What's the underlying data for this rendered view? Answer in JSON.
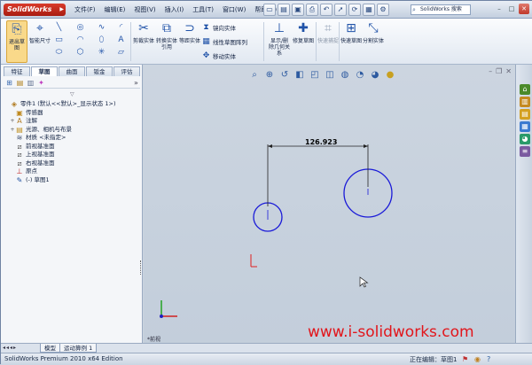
{
  "app": {
    "logo_text": "SolidWorks",
    "menu": [
      "文件(F)",
      "编辑(E)",
      "视图(V)",
      "插入(I)",
      "工具(T)",
      "窗口(W)",
      "帮助(H)"
    ],
    "search_placeholder": "SolidWorks 搜索"
  },
  "ribbon": {
    "exit_sketch": "退出草图",
    "smart_dim": "智能尺寸",
    "trim": "剪裁实体",
    "convert": "转换实体引用",
    "offset": "等距实体",
    "mirror": "镜向实体",
    "linear_pattern": "线性草图阵列",
    "move": "移动实体",
    "display_relations": "显示/删除几何关系",
    "repair": "修复草图",
    "rapid": "快速捕捉",
    "rapid_sketch": "快速草图",
    "split": "分割实体"
  },
  "left_panel": {
    "tabs": [
      "特征",
      "草图",
      "曲面",
      "钣金",
      "评估"
    ],
    "active_tab": 1,
    "tree": [
      {
        "label": "零件1 (默认<<默认>_显示状态 1>)",
        "icon": "part-icon",
        "exp": ""
      },
      {
        "label": "传感器",
        "icon": "sensor-icon",
        "exp": ""
      },
      {
        "label": "注解",
        "icon": "annotation-icon",
        "exp": "+"
      },
      {
        "label": "光源、相机与布景",
        "icon": "lights-icon",
        "exp": "+"
      },
      {
        "label": "材质 <未指定>",
        "icon": "material-icon",
        "exp": ""
      },
      {
        "label": "前视基准面",
        "icon": "plane-icon",
        "exp": ""
      },
      {
        "label": "上视基准面",
        "icon": "plane-icon",
        "exp": ""
      },
      {
        "label": "右视基准面",
        "icon": "plane-icon",
        "exp": ""
      },
      {
        "label": "原点",
        "icon": "origin-icon",
        "exp": ""
      },
      {
        "label": "(-) 草图1",
        "icon": "sketch-icon",
        "exp": ""
      }
    ]
  },
  "viewport": {
    "dimension_value": "126.923",
    "view_label": "*前视",
    "watermark": "www.i-solidworks.com"
  },
  "bottom": {
    "tabs": [
      "模型",
      "运动算例 1"
    ],
    "status_left": "SolidWorks Premium 2010 x64 Edition",
    "status_right": "正在编辑：草图1"
  }
}
